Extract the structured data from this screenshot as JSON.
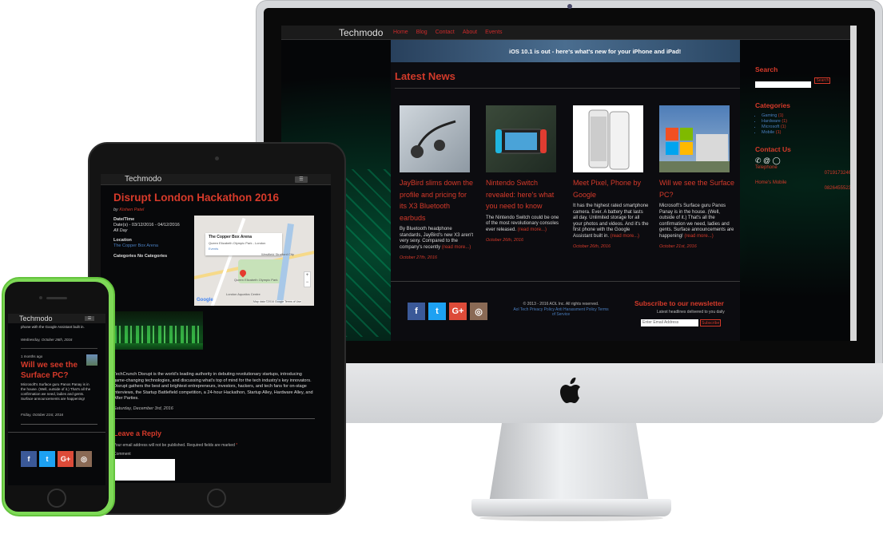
{
  "desktop": {
    "logo": "Techmodo",
    "nav": [
      "Home",
      "Blog",
      "Contact",
      "About",
      "Events"
    ],
    "banner_text": "iOS 10.1 is out - here's what's new for your iPhone and iPad!",
    "section_title": "Latest News",
    "news": [
      {
        "title": "JayBird slims down the profile and pricing for its X3 Bluetooth earbuds",
        "body": "By Bluetooth headphone standards, JayBird's new X3 aren't very sexy. Compared to the company's recently",
        "more": "(read more...)",
        "date": "October 27th, 2016"
      },
      {
        "title": "Nintendo Switch revealed: here's what you need to know",
        "body": "The Nintendo Switch could be one of the most revolutionary consoles ever released.",
        "more": "(read more...)",
        "date": "October 26th, 2016"
      },
      {
        "title": "Meet Pixel, Phone by Google",
        "body": "It has the highest rated smartphone camera. Ever. A battery that lasts all day. Unlimited storage for all your photos and videos. And it's the first phone with the Google Assistant built in.",
        "more": "(read more...)",
        "date": "October 26th, 2016"
      },
      {
        "title": "Will we see the Surface PC?",
        "body": "Microsoft's Surface guru Panos Panay is in the house. (Well, outside of it.) That's all the confirmation we need, ladies and gents. Surface announcements are happening!",
        "more": "(read more...)",
        "date": "October 21st, 2016"
      }
    ],
    "sidebar": {
      "search_heading": "Search",
      "search_button": "Search",
      "categories_heading": "Categories",
      "categories": [
        {
          "name": "Gaming",
          "count": "(1)"
        },
        {
          "name": "Hardware",
          "count": "(1)"
        },
        {
          "name": "Microsoft",
          "count": "(1)"
        },
        {
          "name": "Mobile",
          "count": "(1)"
        }
      ],
      "contact_heading": "Contact Us",
      "contact_icons": "✆ @ ◯",
      "telephone_label": "Telephone",
      "telephone_value": "0719173246",
      "home_mobile_label": "Home's Mobile",
      "home_mobile_value": "0826455523"
    },
    "footer": {
      "copyright": "© 2013 - 2016 AOL Inc. All rights reserved.",
      "links": "Aol Tech Privacy Policy Anti Harassment Policy Terms of Service",
      "newsletter_heading": "Subscribe to our newsletter",
      "newsletter_sub": "Latest headlines delivered to you daily",
      "email_placeholder": "Enter Email Address",
      "subscribe_button": "Subscribe"
    }
  },
  "tablet": {
    "logo": "Techmodo",
    "menu": "☰",
    "title": "Disrupt London Hackathon 2016",
    "by_label": "by",
    "author": "Kishen Patel",
    "date_time_label": "Date/Time",
    "date_range": "Date(s) - 03/12/2016 - 04/12/2016",
    "all_day": "All Day",
    "location_label": "Location",
    "location_value": "The Copper Box Arena",
    "categories": "Categories No Categories",
    "map": {
      "card_title": "The Copper Box Arena",
      "card_address": "Queen Elizabeth Olympic Park - London",
      "card_link": "Events",
      "label_park": "Queen Elizabeth Olympic Park",
      "label_city": "Westfield Stratford City",
      "label_centre": "London Aquatics Centre",
      "google": "Google",
      "footer": "Map data ©2016 Google   Terms of Use"
    },
    "body": "TechCrunch Disrupt is the world's leading authority in debuting revolutionary startups, introducing game-changing technologies, and discussing what's top of mind for the tech industry's key innovators. Disrupt gathers the best and brightest entrepreneurs, investors, hackers, and tech fans for on-stage interviews, the Startup Battlefield competition, a 24-hour Hackathon, Startup Alley, Hardware Alley, and After Parties.",
    "post_date": "Saturday, December 3rd, 2016",
    "reply_heading": "Leave a Reply",
    "reply_note": "Your email address will not be published. Required fields are marked",
    "reply_star": "*",
    "comment_label": "Comment"
  },
  "phone": {
    "logo": "Techmodo",
    "menu": "☰",
    "text1": "phone with the Google Assistant built in.",
    "date1": "Wednesday, October 26th, 2016",
    "ago": "1 months ago",
    "title": "Will we see the Surface PC?",
    "text2": "Microsoft's Surface guru Panos Panay is in the house. (Well, outside of it.) That's all the confirmation we need, ladies and gents. Surface announcements are happening!",
    "date2": "Friday, October 21st, 2016"
  },
  "social": {
    "facebook": "f",
    "twitter": "t",
    "googleplus": "G+",
    "instagram": "◎"
  },
  "colors": {
    "accent": "#d63a2a",
    "link": "#4a7fc0",
    "phone_case": "#7ed957"
  }
}
